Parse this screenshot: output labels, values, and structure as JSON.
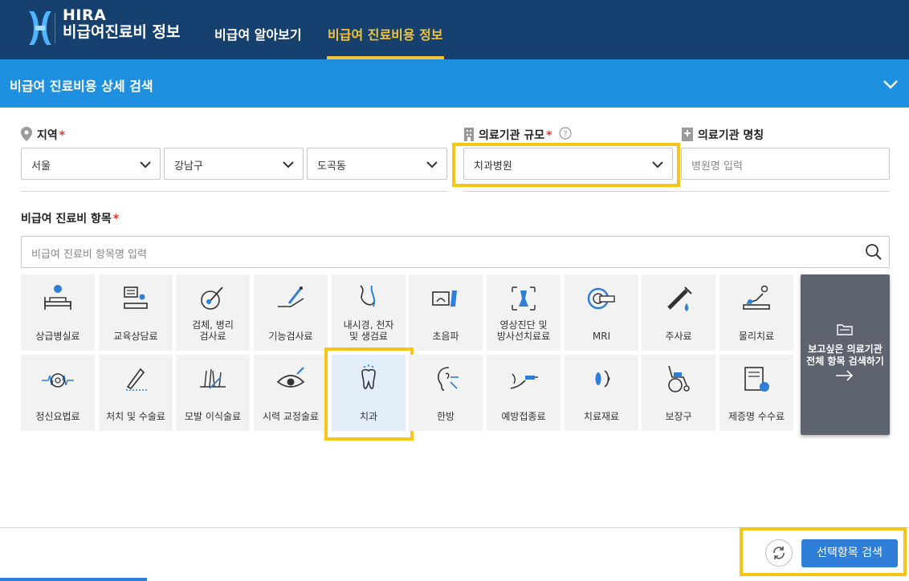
{
  "header": {
    "brand_top": "HIRA",
    "brand_bottom": "비급여진료비 정보",
    "nav": [
      "비급여 알아보기",
      "비급여 진료비용 정보"
    ],
    "active_nav": "비급여 진료비용 정보"
  },
  "search_panel": {
    "title": "비급여 진료비용 상세 검색"
  },
  "filters": {
    "region_label": "지역",
    "region": [
      "서울",
      "강남구",
      "도곡동"
    ],
    "scale_label": "의료기관 규모",
    "scale_value": "치과병원",
    "name_label": "의료기관 명칭",
    "name_placeholder": "병원명 입력",
    "required_mark": "*"
  },
  "items": {
    "label": "비급여 진료비 항목",
    "search_placeholder": "비급여 진료비 항목명 입력",
    "row1": [
      "상급병실료",
      "교육상담료",
      "검체, 병리\n검사료",
      "기능검사료",
      "내시경, 천자\n및 생검료",
      "초음파",
      "영상진단 및\n방사선치료료",
      "MRI",
      "주사료",
      "물리치료"
    ],
    "row2": [
      "정신요법료",
      "처치 및 수술료",
      "모발 이식술료",
      "시력 교정술료",
      "치과",
      "한방",
      "예방접종료",
      "치료재료",
      "보장구",
      "제증명 수수료"
    ],
    "selected": "치과"
  },
  "all_items_button": "보고싶은 의료기관\n전체 항목 검색하기",
  "footer": {
    "submit": "선택항목 검색"
  },
  "colors": {
    "header_bg": "#16416e",
    "accent_yellow": "#f3c43a",
    "panel_blue": "#1f8fe0",
    "button_blue": "#2f7fd8",
    "required_red": "#e53935",
    "highlight": "#f5c518"
  }
}
